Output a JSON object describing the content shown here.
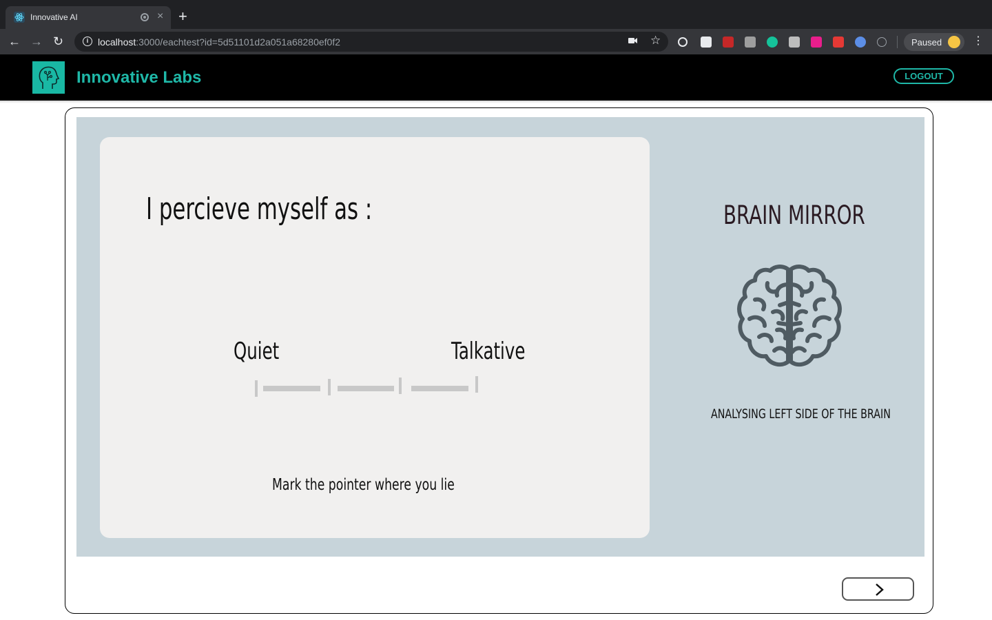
{
  "browser": {
    "tab_title": "Innovative AI",
    "tab_close": "×",
    "new_tab": "+",
    "url_host": "localhost",
    "url_rest": ":3000/eachtest?id=5d51101d2a051a68280ef0f2",
    "profile_label": "Paused",
    "back_icon": "←",
    "forward_icon": "→",
    "reload_icon": "↻",
    "menu_icon": "⋮"
  },
  "app": {
    "brand": "Innovative Labs",
    "logout_label": "LOGOUT",
    "accent_color": "#1fb8a8"
  },
  "question": {
    "prompt": "I percieve myself as :",
    "left_label": "Quiet",
    "right_label": "Talkative",
    "hint": "Mark  the pointer where you lie"
  },
  "sidebar": {
    "title": "BRAIN MIRROR",
    "caption": "ANALYSING LEFT SIDE OF THE BRAIN"
  }
}
